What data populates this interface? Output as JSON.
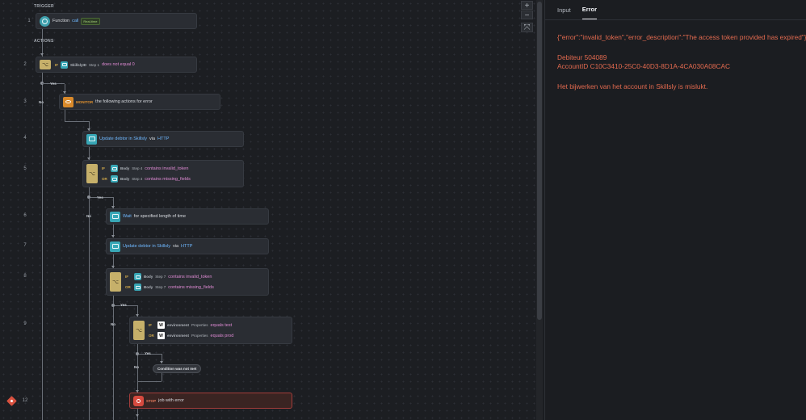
{
  "canvas": {
    "trigger_label": "TRIGGER",
    "actions_label": "ACTIONS",
    "zoom_in": "+",
    "zoom_out": "−",
    "fit": "⤧",
    "branch_yes": "Yes",
    "branch_no": "No"
  },
  "steps": {
    "s1": {
      "num": "1",
      "name": "Function",
      "link": "call",
      "badge": "Real-time"
    },
    "s2": {
      "num": "2",
      "kw": "IF",
      "field": "SkillslyID",
      "step": "Step 1",
      "op": "does not equal 0"
    },
    "s3": {
      "num": "3",
      "kw": "MONITOR",
      "text": "the following actions for error"
    },
    "s4": {
      "num": "4",
      "text": "Update debtor in Skillsly",
      "via": "via",
      "link": "HTTP"
    },
    "s5": {
      "num": "5",
      "if": "IF",
      "or": "OR",
      "field": "Body",
      "step": "Step 4",
      "op1": "contains invalid_token",
      "op2": "contains missing_fields"
    },
    "s6": {
      "num": "6",
      "link": "Wait",
      "text": "for specified length of time"
    },
    "s7": {
      "num": "7",
      "text": "Update debtor in Skillsly",
      "via": "via",
      "link": "HTTP"
    },
    "s8": {
      "num": "8",
      "if": "IF",
      "or": "OR",
      "field": "Body",
      "step": "Step 7",
      "op1": "contains invalid_token",
      "op2": "contains missing_fields"
    },
    "s9": {
      "num": "9",
      "if": "IF",
      "or": "OR",
      "field": "environment",
      "prop": "Properties",
      "op1": "equals test",
      "op2": "equals prod",
      "logo": "W"
    },
    "cond_not_met": "Condition was not met",
    "s12": {
      "num": "12",
      "kw": "STOP",
      "text": "job with error"
    }
  },
  "panel": {
    "tabs": [
      "Input",
      "Error"
    ],
    "active_tab": "Error",
    "error_json": "{\"error\":\"invalid_token\",\"error_description\":\"The access token provided has expired\"}",
    "debiteur": "Debiteur 504089",
    "account_id": "AccountID C10C3410-25C0-40D3-8D1A-4CA030A08CAC",
    "message": "Het bijwerken van het account in Skillsly is mislukt."
  },
  "colors": {
    "error_text": "#e36a4f",
    "link": "#6fb8ff",
    "condition_op": "#e08bd5",
    "condition_block": "#c6b06a",
    "stop_border": "#a33d3a"
  }
}
